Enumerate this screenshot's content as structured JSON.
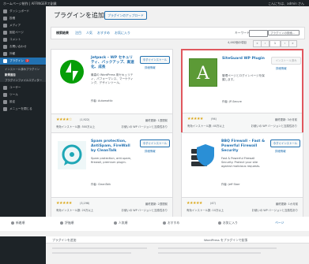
{
  "adminbar": {
    "left_text": "ホームページ制作 | AFFINGERで副業",
    "right_text": "こんにちは、admin さん"
  },
  "sidebar": {
    "items": [
      {
        "label": "ダッシュボード"
      },
      {
        "label": "投稿"
      },
      {
        "label": "メディア"
      },
      {
        "label": "固定ページ"
      },
      {
        "label": "コメント"
      },
      {
        "label": "お問い合わせ"
      },
      {
        "label": "外観"
      },
      {
        "label": "プラグイン",
        "badge": "2"
      },
      {
        "label": "ユーザー"
      },
      {
        "label": "ツール"
      },
      {
        "label": "設定"
      },
      {
        "label": "メニューを閉じる"
      }
    ],
    "submenu": [
      {
        "label": "インストール済みプラグイン"
      },
      {
        "label": "新規追加"
      },
      {
        "label": "プラグインファイルエディター"
      }
    ]
  },
  "main": {
    "title": "プラグインを追加",
    "upload_label": "プラグインのアップロード",
    "tabs": [
      "検索結果",
      "注目",
      "人気",
      "おすすめ",
      "お気に入り"
    ],
    "keyword_label": "キーワード",
    "search_placeholder": "プラグインの検索...",
    "count": "4,462個の項目",
    "pages": [
      "«",
      "‹",
      "1",
      "›",
      "»"
    ]
  },
  "plugins": [
    {
      "name": "Jetpack – WP セキュリティ、バックアップ、高速化、成長",
      "desc": "最高の WordPress 用セキュリティ、パフォーマンス、マーケティング、デザインツール。",
      "author": "作者: Automattic",
      "action": "今すぐインストール",
      "more": "詳細情報",
      "stars": "★★★★☆",
      "ratings": "(1,922)",
      "installs": "有効インストール数: 500万以上",
      "updated": "最終更新: 1週間前",
      "compat": "お使いの WP バージョンと互換性あり",
      "icon": "jetpack-bolt-icon",
      "icon_color": "#069e08"
    },
    {
      "name": "SiteGuard WP Plugin",
      "desc": "管理ページとログインページを保護します。",
      "author": "作者: JP-Secure",
      "action": "インストール済み",
      "more": "詳細情報",
      "stars": "★★★★★",
      "ratings": "(94)",
      "installs": "有効インストール数: 40万以上",
      "updated": "最終更新: 3か月前",
      "compat": "お使いの WP バージョンと互換性あり",
      "icon": "letter-a-icon",
      "icon_color": "#4a8a2a"
    },
    {
      "name": "Spam protection, AntiSpam, FireWall by CleanTalk",
      "desc": "Spam protection, anti-spam, firewall, premium plugin.",
      "author": "作者: CleanTalk",
      "action": "今すぐインストール",
      "more": "詳細情報",
      "stars": "★★★★★",
      "ratings": "(3,196)",
      "installs": "有効インストール数: 20万以上",
      "updated": "最終更新: 2週間前",
      "compat": "お使いの WP バージョンと互換性あり",
      "icon": "speech-bubble-icon",
      "icon_color": "#1ea7b6"
    },
    {
      "name": "BBQ Firewall – Fast & Powerful Firewall Security",
      "desc": "Fast & Powerful Firewall Security. Protect your site against malicious requests.",
      "author": "作者: Jeff Starr",
      "action": "今すぐインストール",
      "more": "詳細情報",
      "stars": "★★★★★",
      "ratings": "(47)",
      "installs": "有効インストール数: 10万以上",
      "updated": "最終更新: 1か月前",
      "compat": "お使いの WP バージョンと互換性あり",
      "icon": "server-shield-icon",
      "icon_color": "#2a8fd6"
    }
  ],
  "bottombar": [
    "新着順",
    "評価順",
    "人気順",
    "おすすめ",
    "お気に入り",
    "ページ"
  ],
  "shot2": {
    "left": "プラグインを追加",
    "right": "WordPress をプラグインで拡張"
  },
  "colors": {
    "highlight": "#e0575e",
    "admin_dark": "#1d2327",
    "accent": "#2271b1"
  }
}
